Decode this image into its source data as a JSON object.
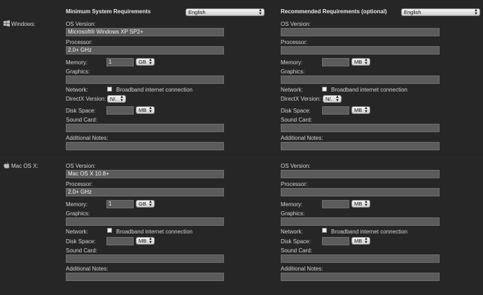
{
  "headers": {
    "minimum": "Minimum System Requirements",
    "recommended": "Recommended Requirements (optional)",
    "language_min": "English",
    "language_rec": "English"
  },
  "labels": {
    "os_version": "OS Version:",
    "processor": "Processor:",
    "memory": "Memory:",
    "graphics": "Graphics:",
    "network": "Network:",
    "broadband": "Broadband internet connection",
    "directx": "DirectX Version:",
    "disk_space": "Disk Space:",
    "sound_card": "Sound Card:",
    "additional_notes": "Additional Notes:"
  },
  "windows": {
    "os_name": "Windows:",
    "min": {
      "os_version": "Microsoft® Windows XP SP2+",
      "processor": "2.0+ GHz",
      "memory": "1",
      "memory_unit": "GB",
      "directx": "N/.",
      "disk_unit": "MB"
    },
    "rec": {
      "memory_unit": "MB",
      "directx": "N/.",
      "disk_unit": "MB"
    }
  },
  "mac": {
    "os_name": "Mac OS X:",
    "min": {
      "os_version": "Mac OS X 10.8+",
      "processor": "2.0+ GHz",
      "memory": "1",
      "memory_unit": "GB",
      "disk_unit": "MB"
    },
    "rec": {
      "memory_unit": "MB",
      "disk_unit": "MB"
    }
  },
  "icons": {
    "windows": "windows-logo-icon",
    "apple": "apple-logo-icon",
    "arrows": "updown-arrows-icon"
  }
}
